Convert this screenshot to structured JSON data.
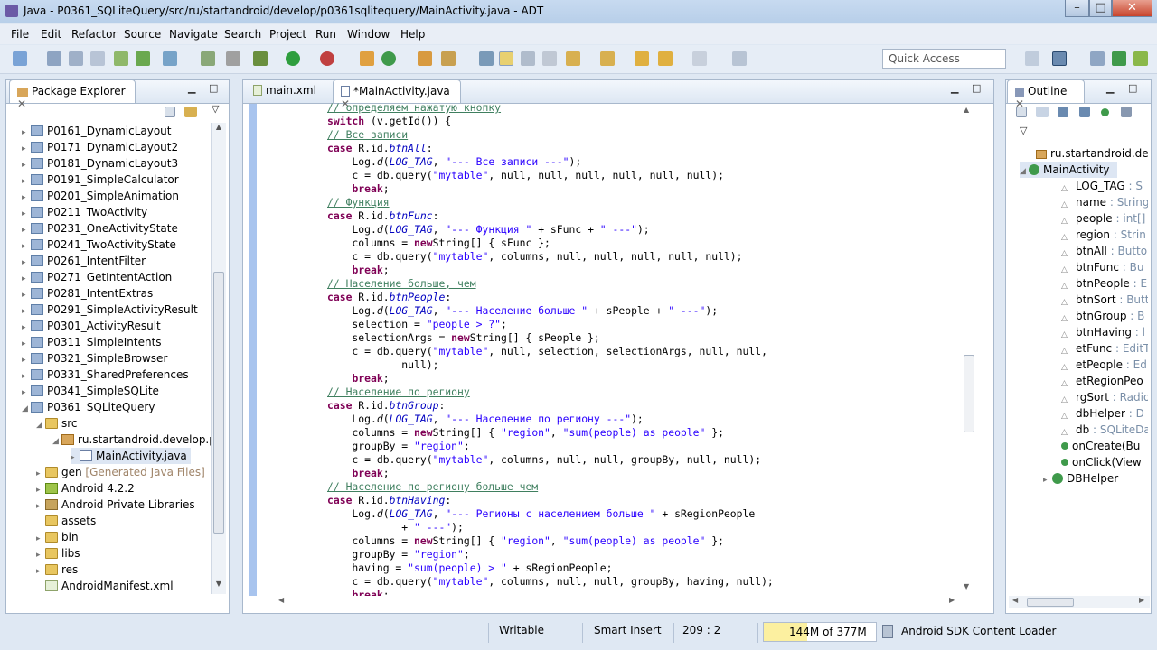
{
  "window": {
    "title": "Java - P0361_SQLiteQuery/src/ru/startandroid/develop/p0361sqlitequery/MainActivity.java - ADT"
  },
  "menu": [
    "File",
    "Edit",
    "Refactor",
    "Source",
    "Navigate",
    "Search",
    "Project",
    "Run",
    "Window",
    "Help"
  ],
  "quick_access": {
    "placeholder": "Quick Access"
  },
  "package_explorer": {
    "title": "Package Explorer",
    "items": [
      "P0161_DynamicLayout",
      "P0171_DynamicLayout2",
      "P0181_DynamicLayout3",
      "P0191_SimpleCalculator",
      "P0201_SimpleAnimation",
      "P0211_TwoActivity",
      "P0231_OneActivityState",
      "P0241_TwoActivityState",
      "P0261_IntentFilter",
      "P0271_GetIntentAction",
      "P0281_IntentExtras",
      "P0291_SimpleActivityResult",
      "P0301_ActivityResult",
      "P0311_SimpleIntents",
      "P0321_SimpleBrowser",
      "P0331_SharedPreferences",
      "P0341_SimpleSQLite",
      "P0361_SQLiteQuery"
    ],
    "src": "src",
    "package": "ru.startandroid.develop.p",
    "file": "MainActivity.java",
    "gen": "gen",
    "gen_note": "[Generated Java Files]",
    "android": "Android 4.2.2",
    "private_libs": "Android Private Libraries",
    "assets": "assets",
    "bin": "bin",
    "libs": "libs",
    "res": "res",
    "manifest": "AndroidManifest.xml"
  },
  "editor": {
    "tabs": [
      "main.xml",
      "*MainActivity.java"
    ],
    "lines": [
      [
        [
          "cm",
          "// определяем нажатую кнопку"
        ]
      ],
      [
        [
          "kw",
          "switch"
        ],
        [
          "",
          "(v.getId()) {"
        ]
      ],
      [
        [
          "cm",
          "// Все записи"
        ]
      ],
      [
        [
          "kw",
          "case"
        ],
        [
          "",
          "R.id."
        ],
        [
          "it",
          "btnAll"
        ],
        [
          "",
          ":"
        ]
      ],
      [
        [
          "",
          "    Log."
        ],
        [
          "ita",
          "d"
        ],
        [
          "",
          "("
        ],
        [
          "fld",
          "LOG_TAG"
        ],
        [
          "",
          ", "
        ],
        [
          "st",
          "\"--- Все записи ---\""
        ],
        [
          "",
          ");"
        ]
      ],
      [
        [
          "",
          "    c = db.query("
        ],
        [
          "st",
          "\"mytable\""
        ],
        [
          "",
          ", null, null, null, null, null, null);"
        ]
      ],
      [
        [
          "",
          "    "
        ],
        [
          "kw",
          "break"
        ],
        [
          "",
          ";"
        ]
      ],
      [
        [
          "cm",
          "// Функция"
        ]
      ],
      [
        [
          "kw",
          "case"
        ],
        [
          "",
          "R.id."
        ],
        [
          "it",
          "btnFunc"
        ],
        [
          "",
          ":"
        ]
      ],
      [
        [
          "",
          "    Log."
        ],
        [
          "ita",
          "d"
        ],
        [
          "",
          "("
        ],
        [
          "fld",
          "LOG_TAG"
        ],
        [
          "",
          ", "
        ],
        [
          "st",
          "\"--- Функция \""
        ],
        [
          "",
          " + sFunc + "
        ],
        [
          "st",
          "\" ---\""
        ],
        [
          "",
          ");"
        ]
      ],
      [
        [
          "",
          "    columns = "
        ],
        [
          "kw",
          "new"
        ],
        [
          "",
          "String[] { sFunc };"
        ]
      ],
      [
        [
          "",
          "    c = db.query("
        ],
        [
          "st",
          "\"mytable\""
        ],
        [
          "",
          ", columns, null, null, null, null, null);"
        ]
      ],
      [
        [
          "",
          "    "
        ],
        [
          "kw",
          "break"
        ],
        [
          "",
          ";"
        ]
      ],
      [
        [
          "cm",
          "// Население больше, чем"
        ]
      ],
      [
        [
          "kw",
          "case"
        ],
        [
          "",
          "R.id."
        ],
        [
          "it",
          "btnPeople"
        ],
        [
          "",
          ":"
        ]
      ],
      [
        [
          "",
          "    Log."
        ],
        [
          "ita",
          "d"
        ],
        [
          "",
          "("
        ],
        [
          "fld",
          "LOG_TAG"
        ],
        [
          "",
          ", "
        ],
        [
          "st",
          "\"--- Население больше \""
        ],
        [
          "",
          " + sPeople + "
        ],
        [
          "st",
          "\" ---\""
        ],
        [
          "",
          ");"
        ]
      ],
      [
        [
          "",
          "    selection = "
        ],
        [
          "st",
          "\"people > ?\""
        ],
        [
          "",
          ";"
        ]
      ],
      [
        [
          "",
          "    selectionArgs = "
        ],
        [
          "kw",
          "new"
        ],
        [
          "",
          "String[] { sPeople };"
        ]
      ],
      [
        [
          "",
          "    c = db.query("
        ],
        [
          "st",
          "\"mytable\""
        ],
        [
          "",
          ", null, selection, selectionArgs, null, null,"
        ]
      ],
      [
        [
          "",
          "            null);"
        ]
      ],
      [
        [
          "",
          "    "
        ],
        [
          "kw",
          "break"
        ],
        [
          "",
          ";"
        ]
      ],
      [
        [
          "cm",
          "// Население по региону"
        ]
      ],
      [
        [
          "kw",
          "case"
        ],
        [
          "",
          "R.id."
        ],
        [
          "it",
          "btnGroup"
        ],
        [
          "",
          ":"
        ]
      ],
      [
        [
          "",
          "    Log."
        ],
        [
          "ita",
          "d"
        ],
        [
          "",
          "("
        ],
        [
          "fld",
          "LOG_TAG"
        ],
        [
          "",
          ", "
        ],
        [
          "st",
          "\"--- Население по региону ---\""
        ],
        [
          "",
          ");"
        ]
      ],
      [
        [
          "",
          "    columns = "
        ],
        [
          "kw",
          "new"
        ],
        [
          "",
          "String[] { "
        ],
        [
          "st",
          "\"region\""
        ],
        [
          "",
          ", "
        ],
        [
          "st",
          "\"sum(people) as people\""
        ],
        [
          "",
          " };"
        ]
      ],
      [
        [
          "",
          "    groupBy = "
        ],
        [
          "st",
          "\"region\""
        ],
        [
          "",
          ";"
        ]
      ],
      [
        [
          "",
          "    c = db.query("
        ],
        [
          "st",
          "\"mytable\""
        ],
        [
          "",
          ", columns, null, null, groupBy, null, null);"
        ]
      ],
      [
        [
          "",
          "    "
        ],
        [
          "kw",
          "break"
        ],
        [
          "",
          ";"
        ]
      ],
      [
        [
          "cm",
          "// Население по региону больше чем"
        ]
      ],
      [
        [
          "kw",
          "case"
        ],
        [
          "",
          "R.id."
        ],
        [
          "it",
          "btnHaving"
        ],
        [
          "",
          ":"
        ]
      ],
      [
        [
          "",
          "    Log."
        ],
        [
          "ita",
          "d"
        ],
        [
          "",
          "("
        ],
        [
          "fld",
          "LOG_TAG"
        ],
        [
          "",
          ", "
        ],
        [
          "st",
          "\"--- Регионы с населением больше \""
        ],
        [
          "",
          " + sRegionPeople"
        ]
      ],
      [
        [
          "",
          "            + "
        ],
        [
          "st",
          "\" ---\""
        ],
        [
          "",
          ");"
        ]
      ],
      [
        [
          "",
          "    columns = "
        ],
        [
          "kw",
          "new"
        ],
        [
          "",
          "String[] { "
        ],
        [
          "st",
          "\"region\""
        ],
        [
          "",
          ", "
        ],
        [
          "st",
          "\"sum(people) as people\""
        ],
        [
          "",
          " };"
        ]
      ],
      [
        [
          "",
          "    groupBy = "
        ],
        [
          "st",
          "\"region\""
        ],
        [
          "",
          ";"
        ]
      ],
      [
        [
          "",
          "    having = "
        ],
        [
          "st",
          "\"sum(people) > \""
        ],
        [
          "",
          " + sRegionPeople;"
        ]
      ],
      [
        [
          "",
          "    c = db.query("
        ],
        [
          "st",
          "\"mytable\""
        ],
        [
          "",
          ", columns, null, null, groupBy, having, null);"
        ]
      ],
      [
        [
          "",
          "    "
        ],
        [
          "kw",
          "break"
        ],
        [
          "",
          ";"
        ]
      ]
    ]
  },
  "outline": {
    "title": "Outline",
    "package": "ru.startandroid.de",
    "class": "MainActivity",
    "members": [
      {
        "name": "LOG_TAG",
        "type": " : S"
      },
      {
        "name": "name",
        "type": " : String"
      },
      {
        "name": "people",
        "type": " : int[]"
      },
      {
        "name": "region",
        "type": " : Strin"
      },
      {
        "name": "btnAll",
        "type": " : Butto"
      },
      {
        "name": "btnFunc",
        "type": " : Bu"
      },
      {
        "name": "btnPeople",
        "type": " : E"
      },
      {
        "name": "btnSort",
        "type": " : Butt"
      },
      {
        "name": "btnGroup",
        "type": " : B"
      },
      {
        "name": "btnHaving",
        "type": " : l"
      },
      {
        "name": "etFunc",
        "type": " : EditT"
      },
      {
        "name": "etPeople",
        "type": " : Ed"
      },
      {
        "name": "etRegionPeo",
        "type": ""
      },
      {
        "name": "rgSort",
        "type": " : Radio"
      },
      {
        "name": "dbHelper",
        "type": " : D"
      },
      {
        "name": "db",
        "type": " : SQLiteDa"
      },
      {
        "name": "onCreate(Bu",
        "type": ""
      },
      {
        "name": "onClick(View",
        "type": ""
      }
    ],
    "inner": "DBHelper"
  },
  "status": {
    "writable": "Writable",
    "insert": "Smart Insert",
    "position": "209 : 2",
    "heap": "144M of 377M",
    "loader": "Android SDK Content Loader"
  },
  "colors": {
    "keyword": "#7f0055",
    "comment": "#3f7f5f",
    "string": "#2a00ff",
    "field": "#0000c0"
  }
}
